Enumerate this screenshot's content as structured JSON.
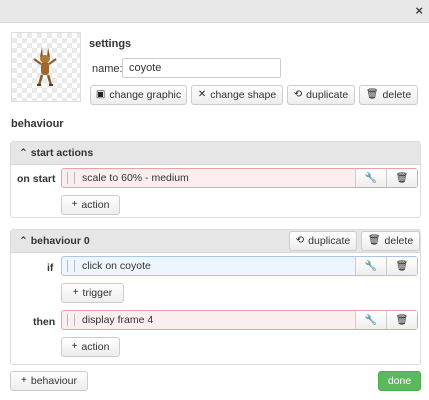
{
  "dialog": {
    "close_glyph": "×"
  },
  "settings": {
    "title": "settings",
    "name_label": "name:",
    "name_value": "coyote",
    "buttons": {
      "change_graphic": "change graphic",
      "change_shape": "change shape",
      "duplicate": "duplicate",
      "delete": "delete"
    }
  },
  "behaviour_section": {
    "label": "behaviour"
  },
  "start_actions": {
    "title": "start actions",
    "row_label": "on start",
    "action_text": "scale to 60% - medium",
    "add_action": "action"
  },
  "behaviour0": {
    "title": "behaviour 0",
    "duplicate": "duplicate",
    "delete": "delete",
    "if_label": "if",
    "trigger_text": "click on coyote",
    "add_trigger": "trigger",
    "then_label": "then",
    "action_text": "display frame 4",
    "add_action": "action"
  },
  "footer": {
    "add_behaviour": "behaviour",
    "done": "done"
  },
  "colors": {
    "done_green": "#5cb85c",
    "action_red": "#fbeeee",
    "trigger_blue": "#eef6fd"
  }
}
